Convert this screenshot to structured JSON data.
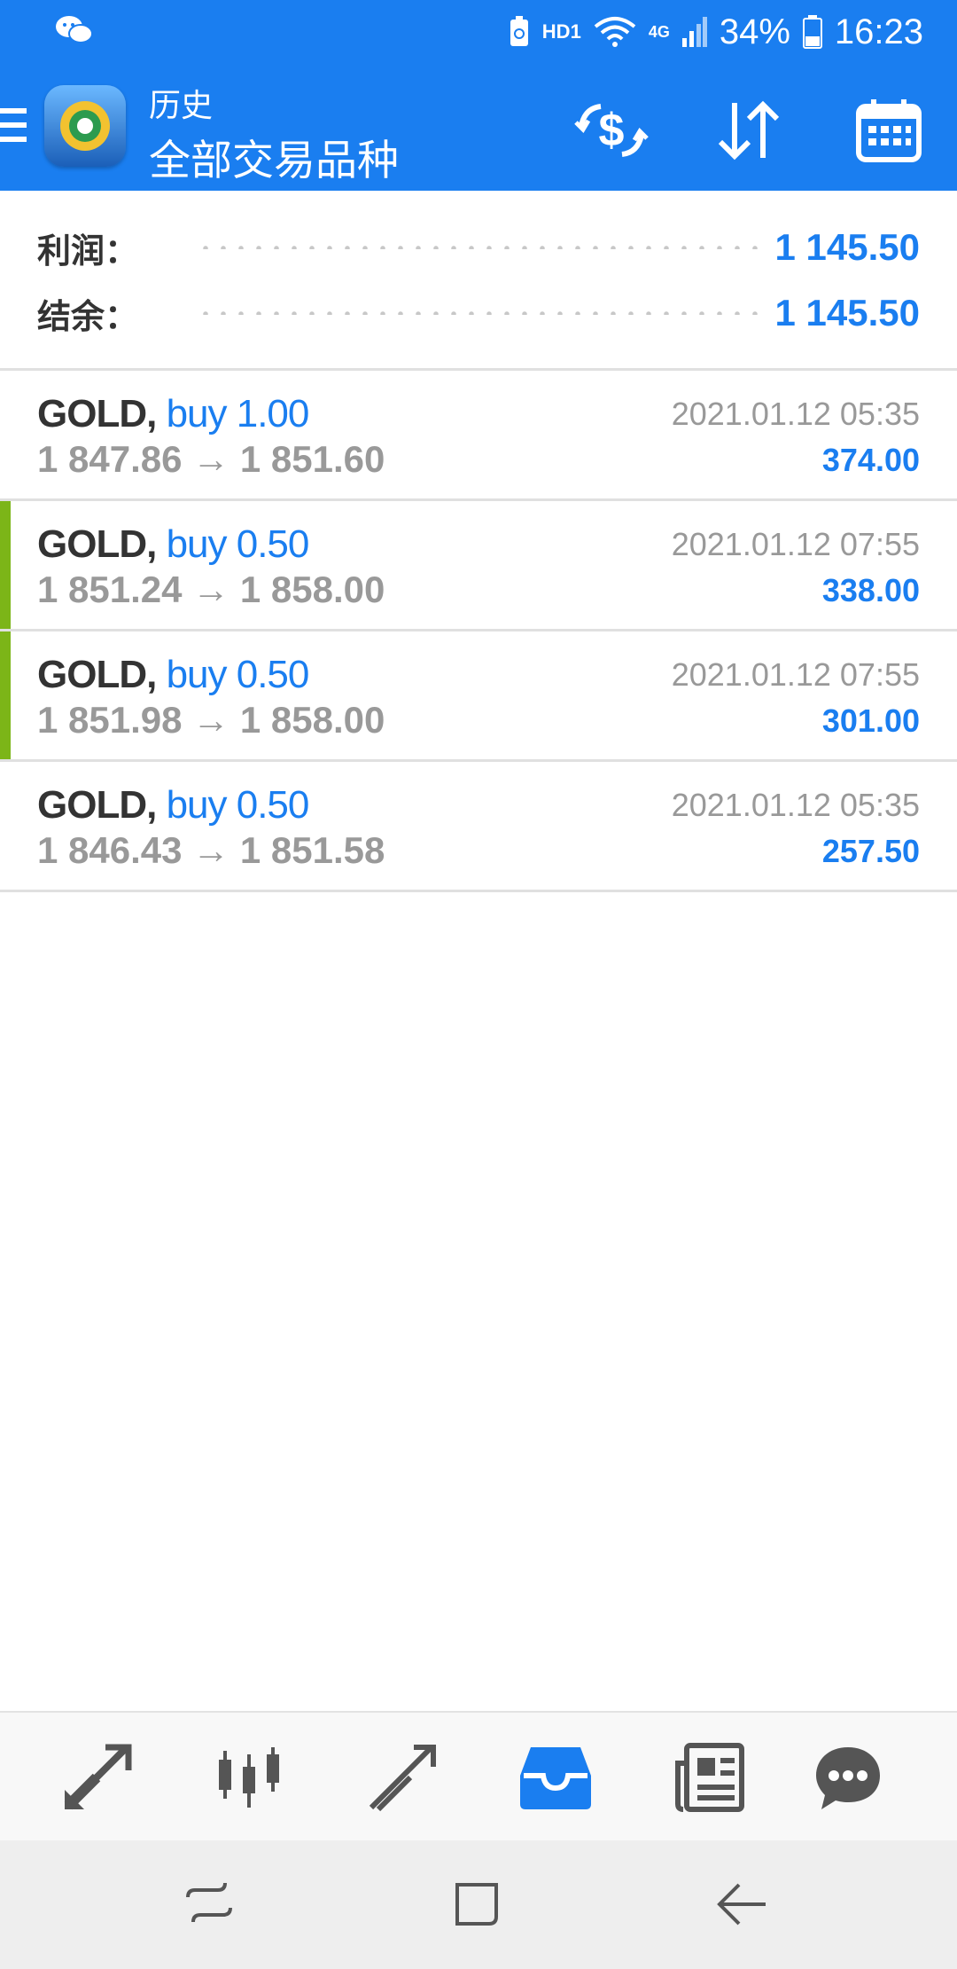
{
  "status_bar": {
    "network": "HD1",
    "signal": "4G",
    "battery": "34%",
    "time": "16:23"
  },
  "header": {
    "subtitle": "历史",
    "title": "全部交易品种"
  },
  "summary": {
    "profit_label": "利润：",
    "profit_value": "1 145.50",
    "balance_label": "结余：",
    "balance_value": "1 145.50"
  },
  "trades": [
    {
      "symbol": "GOLD,",
      "side": "buy 1.00",
      "open": "1 847.86",
      "close": "1 851.60",
      "time": "2021.01.12 05:35",
      "profit": "374.00",
      "marker": false
    },
    {
      "symbol": "GOLD,",
      "side": "buy 0.50",
      "open": "1 851.24",
      "close": "1 858.00",
      "time": "2021.01.12 07:55",
      "profit": "338.00",
      "marker": true
    },
    {
      "symbol": "GOLD,",
      "side": "buy 0.50",
      "open": "1 851.98",
      "close": "1 858.00",
      "time": "2021.01.12 07:55",
      "profit": "301.00",
      "marker": true
    },
    {
      "symbol": "GOLD,",
      "side": "buy 0.50",
      "open": "1 846.43",
      "close": "1 851.58",
      "time": "2021.01.12 05:35",
      "profit": "257.50",
      "marker": false
    }
  ],
  "arrow": "→",
  "bottom_nav": [
    "quotes-icon",
    "chart-icon",
    "trade-icon",
    "history-icon",
    "news-icon",
    "chat-icon"
  ],
  "colors": {
    "accent": "#1a7ef0",
    "marker": "#7cb518",
    "muted": "#999999"
  }
}
